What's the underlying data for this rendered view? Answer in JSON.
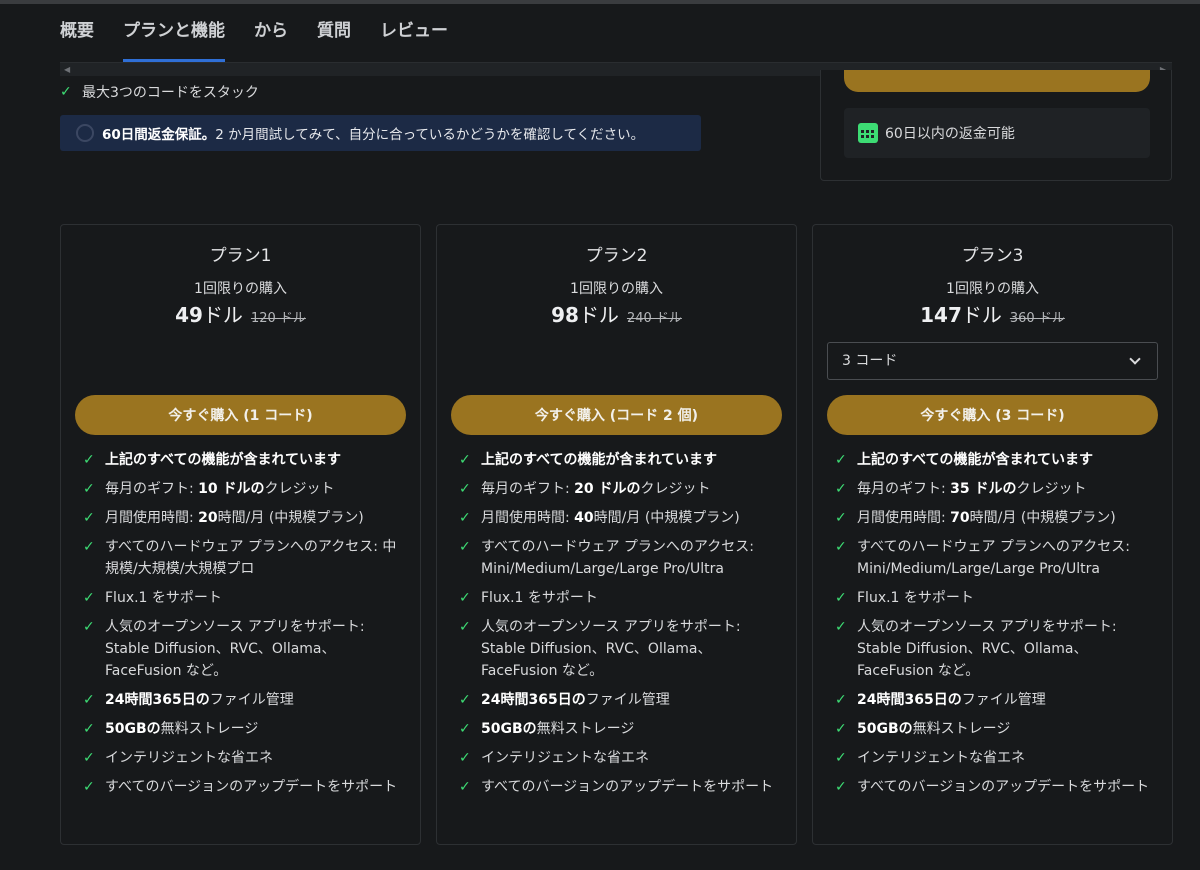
{
  "nav": {
    "tabs": [
      {
        "label": "概要",
        "active": false
      },
      {
        "label": "プランと機能",
        "active": true
      },
      {
        "label": "から",
        "active": false
      },
      {
        "label": "質問",
        "active": false
      },
      {
        "label": "レビュー",
        "active": false
      }
    ]
  },
  "scroll": {
    "left_arrow": "◀",
    "right_arrow": "▶"
  },
  "intro": {
    "feature_stack": "最大3つのコードをスタック",
    "refund_bold": "60日間返金保証。",
    "refund_text": "2 か月間試してみて、自分に合っているかどうかを確認してください。"
  },
  "side": {
    "refund_label": "60日以内の返金可能"
  },
  "colors": {
    "accent_gold": "#9a7420",
    "check_green": "#3ddc74",
    "tab_underline": "#2f6fd6"
  },
  "plans": [
    {
      "name": "プラン1",
      "type": "1回限りの購入",
      "price_num": "49",
      "price_unit": "ドル",
      "old_price": "120 ドル",
      "button": "今すぐ購入 (1 コード)",
      "features": {
        "all": "上記のすべての機能が含まれています",
        "gift_pre": "毎月のギフト: ",
        "gift_bold": "10 ドルの",
        "gift_post": "クレジット",
        "usage_pre": "月間使用時間: ",
        "usage_bold": "20",
        "usage_post": "時間/月 (中規模プラン)",
        "hw": "すべてのハードウェア プランへのアクセス: 中規模/大規模/大規模プロ",
        "flux": "Flux.1 をサポート",
        "apps": "人気のオープンソース アプリをサポート: Stable Diffusion、RVC、Ollama、FaceFusion など。",
        "files_bold": "24時間365日の",
        "files_post": "ファイル管理",
        "storage_bold": "50GBの",
        "storage_post": "無料ストレージ",
        "energy": "インテリジェントな省エネ",
        "updates": "すべてのバージョンのアップデートをサポート"
      }
    },
    {
      "name": "プラン2",
      "type": "1回限りの購入",
      "price_num": "98",
      "price_unit": "ドル",
      "old_price": "240 ドル",
      "button": "今すぐ購入 (コード 2 個)",
      "features": {
        "all": "上記のすべての機能が含まれています",
        "gift_pre": "毎月のギフト: ",
        "gift_bold": "20 ドルの",
        "gift_post": "クレジット",
        "usage_pre": "月間使用時間: ",
        "usage_bold": "40",
        "usage_post": "時間/月 (中規模プラン)",
        "hw": "すべてのハードウェア プランへのアクセス: Mini/Medium/Large/Large Pro/Ultra",
        "flux": "Flux.1 をサポート",
        "apps": "人気のオープンソース アプリをサポート: Stable Diffusion、RVC、Ollama、FaceFusion など。",
        "files_bold": "24時間365日の",
        "files_post": "ファイル管理",
        "storage_bold": "50GBの",
        "storage_post": "無料ストレージ",
        "energy": "インテリジェントな省エネ",
        "updates": "すべてのバージョンのアップデートをサポート"
      }
    },
    {
      "name": "プラン3",
      "type": "1回限りの購入",
      "price_num": "147",
      "price_unit": "ドル",
      "old_price": "360 ドル",
      "select_value": "3 コード",
      "button": "今すぐ購入 (3 コード)",
      "features": {
        "all": "上記のすべての機能が含まれています",
        "gift_pre": "毎月のギフト: ",
        "gift_bold": "35 ドルの",
        "gift_post": "クレジット",
        "usage_pre": "月間使用時間: ",
        "usage_bold": "70",
        "usage_post": "時間/月 (中規模プラン)",
        "hw": "すべてのハードウェア プランへのアクセス: Mini/Medium/Large/Large Pro/Ultra",
        "flux": "Flux.1 をサポート",
        "apps": "人気のオープンソース アプリをサポート: Stable Diffusion、RVC、Ollama、FaceFusion など。",
        "files_bold": "24時間365日の",
        "files_post": "ファイル管理",
        "storage_bold": "50GBの",
        "storage_post": "無料ストレージ",
        "energy": "インテリジェントな省エネ",
        "updates": "すべてのバージョンのアップデートをサポート"
      }
    }
  ],
  "icons": {
    "check": "✓"
  }
}
